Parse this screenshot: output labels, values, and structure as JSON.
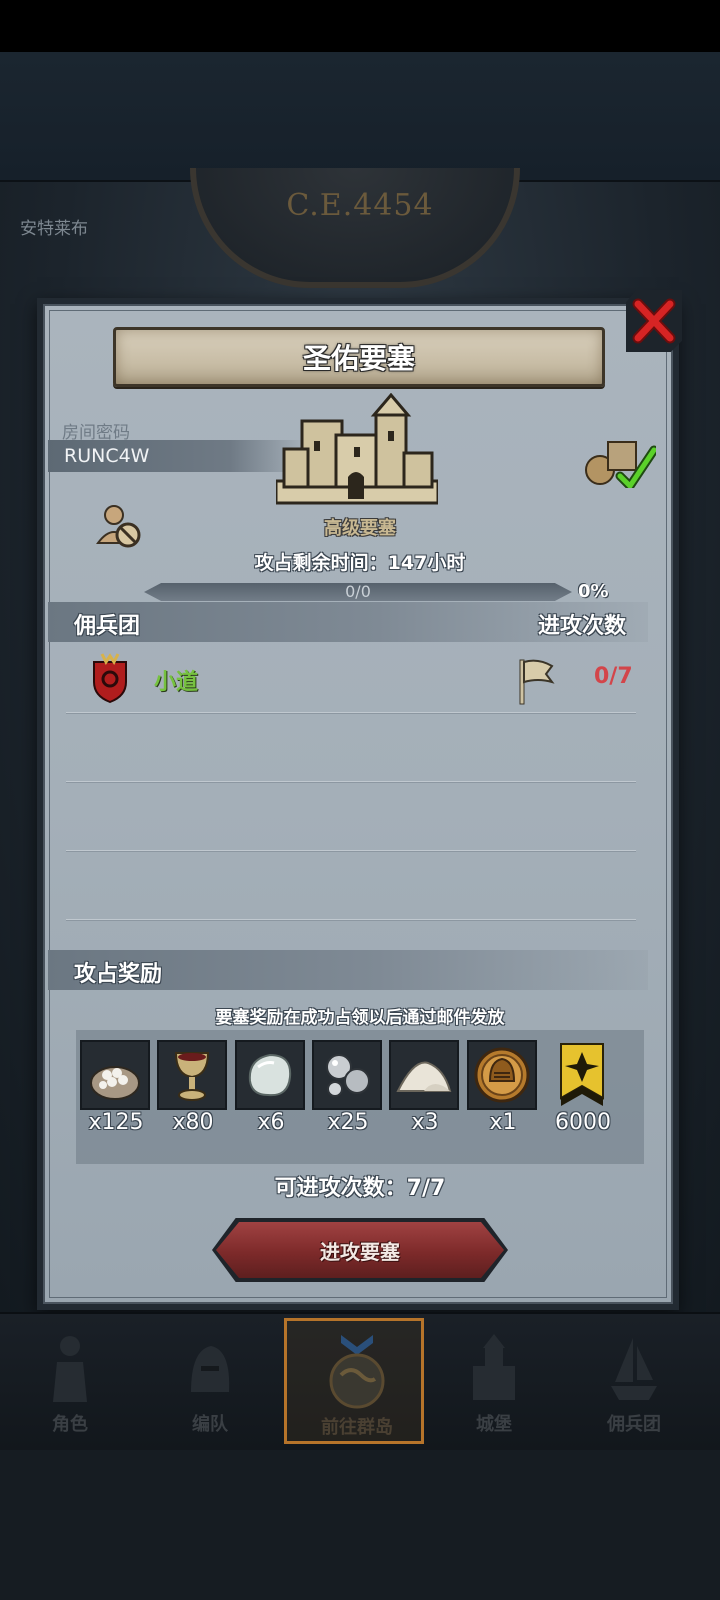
{
  "background": {
    "year": "C.E.4454",
    "place": "安特莱布"
  },
  "dialog": {
    "title": "圣佑要塞",
    "room_label": "房间密码",
    "room_code": "RUNC4W",
    "fortress_type": "高级要塞",
    "time_label": "攻占剩余时间：",
    "time_value": "147",
    "time_unit": "小时",
    "progress_text": "0/0",
    "progress_percent": "0%",
    "progress_value": 0
  },
  "guild_section": {
    "header_left": "佣兵团",
    "header_right": "进攻次数",
    "rows": [
      {
        "name": "小道",
        "attacks": "0/7"
      }
    ]
  },
  "rewards_section": {
    "header": "攻占奖励",
    "note": "要塞奖励在成功占领以后通过邮件发放",
    "items": [
      {
        "icon": "gem-sack-icon",
        "count": "x125"
      },
      {
        "icon": "goblet-icon",
        "count": "x80"
      },
      {
        "icon": "white-stone-icon",
        "count": "x6"
      },
      {
        "icon": "silver-ore-icon",
        "count": "x25"
      },
      {
        "icon": "flour-pile-icon",
        "count": "x3"
      },
      {
        "icon": "knight-helmet-medal-icon",
        "count": "x1"
      },
      {
        "icon": "rank-badge-icon",
        "count": "6000"
      }
    ]
  },
  "attacks_available": "可进攻次数：7/7",
  "attack_button": "进攻要塞",
  "bottom_nav": [
    {
      "label": "角色",
      "icon": "knight-icon"
    },
    {
      "label": "编队",
      "icon": "formation-icon"
    },
    {
      "label": "前往群岛",
      "icon": "world-map-icon",
      "active": true
    },
    {
      "label": "城堡",
      "icon": "castle-icon"
    },
    {
      "label": "佣兵团",
      "icon": "ship-icon"
    }
  ],
  "colors": {
    "guild_name": "#76c23f",
    "attack_count": "#d3454a",
    "active_nav": "#b6742a",
    "button": "#7d2a2a"
  }
}
